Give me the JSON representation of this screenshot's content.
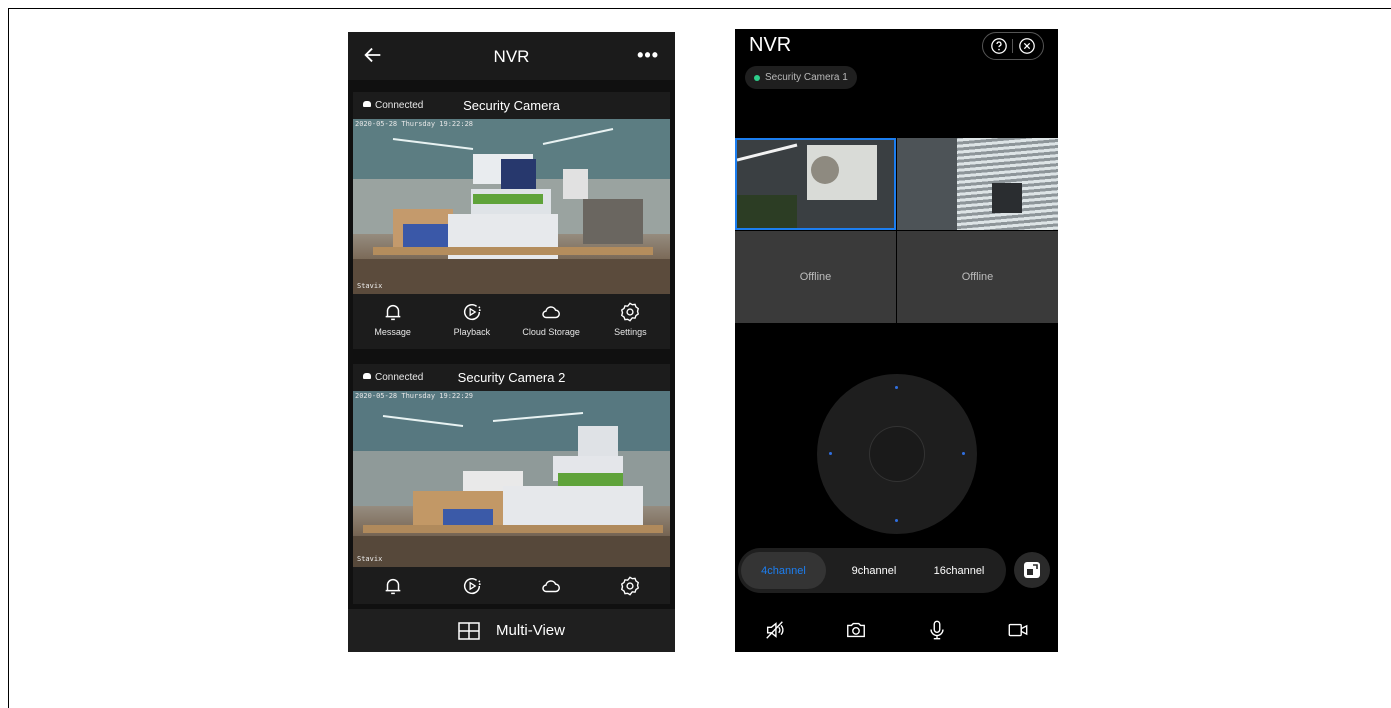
{
  "left_screen": {
    "nav": {
      "title": "NVR",
      "back_icon": "arrow-left-icon",
      "more_label": "•••"
    },
    "cameras": [
      {
        "status": "Connected",
        "name": "Security Camera",
        "timestamp": "2020-05-28  Thursday  19:22:28",
        "brand": "Stavix",
        "actions": [
          {
            "icon": "bell-icon",
            "label": "Message"
          },
          {
            "icon": "playback-icon",
            "label": "Playback"
          },
          {
            "icon": "cloud-icon",
            "label": "Cloud Storage"
          },
          {
            "icon": "gear-icon",
            "label": "Settings"
          }
        ]
      },
      {
        "status": "Connected",
        "name": "Security Camera 2",
        "timestamp": "2020-05-28  Thursday  19:22:29",
        "brand": "Stavix",
        "actions": [
          {
            "icon": "bell-icon"
          },
          {
            "icon": "playback-icon"
          },
          {
            "icon": "cloud-icon"
          },
          {
            "icon": "gear-icon"
          }
        ]
      }
    ],
    "multi_view_label": "Multi-View"
  },
  "right_screen": {
    "title": "NVR",
    "camera_chip": "Security Camera  1",
    "tiles": [
      {
        "state": "live",
        "selected": true
      },
      {
        "state": "live"
      },
      {
        "state": "offline",
        "label": "Offline"
      },
      {
        "state": "offline",
        "label": "Offline"
      }
    ],
    "channel_options": [
      "4channel",
      "9channel",
      "16channel"
    ],
    "selected_channel": "4channel",
    "toolbar": [
      "mute-icon",
      "camera-icon",
      "microphone-icon",
      "video-record-icon"
    ]
  },
  "colors": {
    "accent": "#1c7ef0",
    "online_dot": "#2ecf8b",
    "background": "#000000"
  }
}
